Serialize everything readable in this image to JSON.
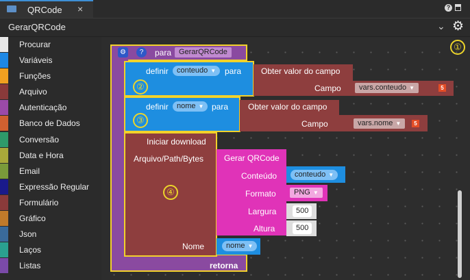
{
  "tab": {
    "title": "QRCode",
    "close": "×"
  },
  "header": {
    "title": "GerarQRCode"
  },
  "sidebar": {
    "items": [
      {
        "label": "Procurar",
        "color": "#e8e8e8"
      },
      {
        "label": "Variáveis",
        "color": "#1e88e5"
      },
      {
        "label": "Funções",
        "color": "#f0a020"
      },
      {
        "label": "Arquivo",
        "color": "#8a3a3a"
      },
      {
        "label": "Autenticação",
        "color": "#9b4aa8"
      },
      {
        "label": "Banco de Dados",
        "color": "#d06030"
      },
      {
        "label": "Conversão",
        "color": "#2e9a6a"
      },
      {
        "label": "Data e Hora",
        "color": "#a8a83a"
      },
      {
        "label": "Email",
        "color": "#7a9a3a"
      },
      {
        "label": "Expressão Regular",
        "color": "#1a1a8a"
      },
      {
        "label": "Formulário",
        "color": "#8a3a3a"
      },
      {
        "label": "Gráfico",
        "color": "#c07a2a"
      },
      {
        "label": "Json",
        "color": "#3a6a9a"
      },
      {
        "label": "Laços",
        "color": "#2aa090"
      },
      {
        "label": "Listas",
        "color": "#7a4aa8"
      }
    ]
  },
  "markers": [
    "①",
    "②",
    "③",
    "④"
  ],
  "blocks": {
    "function": {
      "para": "para",
      "name": "GerarQRCode",
      "retorna": "retorna"
    },
    "set1": {
      "definir": "definir",
      "var": "conteudo",
      "para": "para",
      "get": "Obter valor do campo",
      "campo": "Campo",
      "value": "vars.conteudo"
    },
    "set2": {
      "definir": "definir",
      "var": "nome",
      "para": "para",
      "get": "Obter valor do campo",
      "campo": "Campo",
      "value": "vars.nome"
    },
    "download": {
      "title": "Iniciar download",
      "arg": "Arquivo/Path/Bytes",
      "nome": "Nome",
      "nome_var": "nome"
    },
    "qr": {
      "title": "Gerar QRCode",
      "conteudo_lbl": "Conteúdo",
      "conteudo_var": "conteudo",
      "formato_lbl": "Formato",
      "formato": "PNG",
      "largura_lbl": "Largura",
      "largura": "500",
      "altura_lbl": "Altura",
      "altura": "500"
    }
  }
}
